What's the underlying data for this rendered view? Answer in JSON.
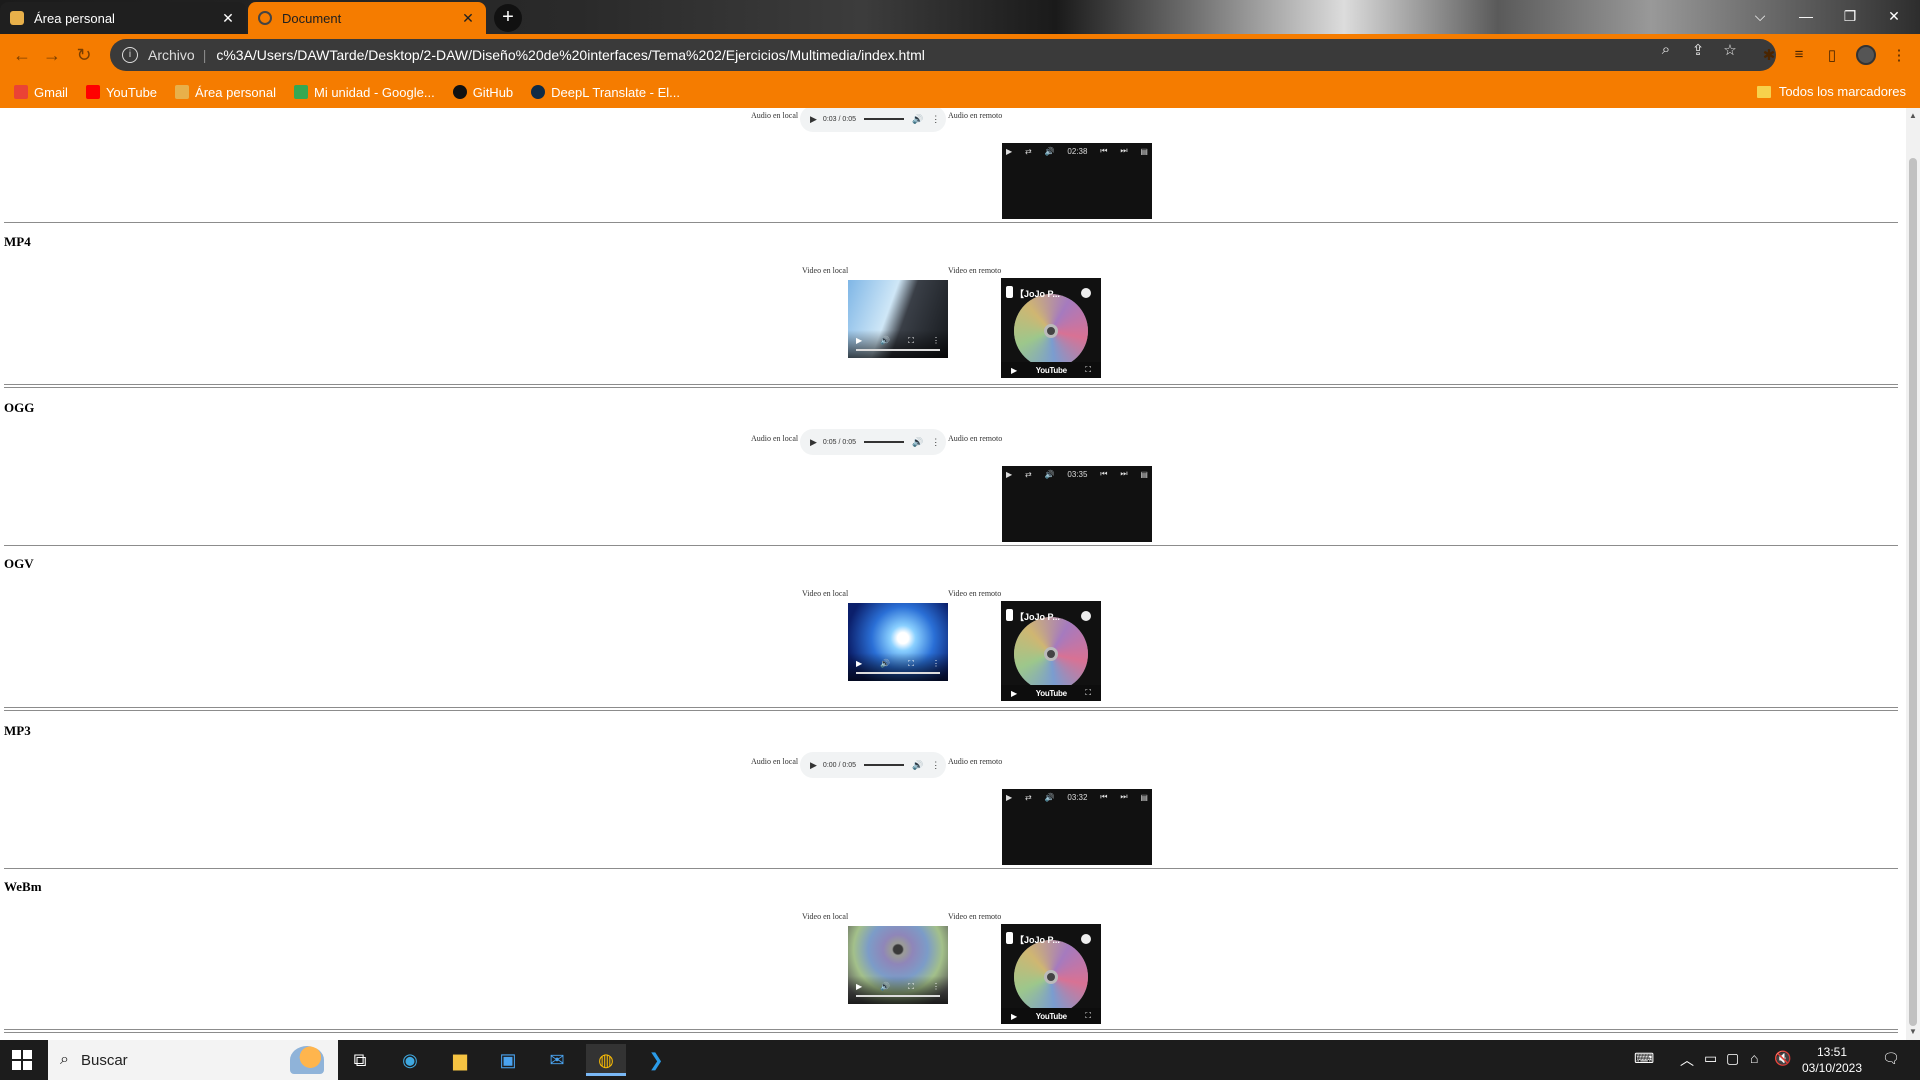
{
  "tabs": [
    {
      "title": "Área personal",
      "active": false
    },
    {
      "title": "Document",
      "active": true
    }
  ],
  "toolbar": {
    "scheme": "Archivo",
    "url": "c%3A/Users/DAWTarde/Desktop/2-DAW/Diseño%20de%20interfaces/Tema%202/Ejercicios/Multimedia/index.html"
  },
  "bookmarks": [
    {
      "label": "Gmail",
      "icon": "gmail-icon",
      "color": "#ea4335"
    },
    {
      "label": "YouTube",
      "icon": "youtube-icon",
      "color": "#ff0000"
    },
    {
      "label": "Área personal",
      "icon": "moodle-icon",
      "color": "#e8b04a"
    },
    {
      "label": "Mi unidad - Google...",
      "icon": "google-drive-icon",
      "color": "#34a853"
    },
    {
      "label": "GitHub",
      "icon": "github-icon",
      "color": "#111111"
    },
    {
      "label": "DeepL Translate - El...",
      "icon": "deepl-icon",
      "color": "#0f2b46"
    }
  ],
  "all_bookmarks": "Todos los marcadores",
  "page": {
    "audio_local": "Audio en local",
    "audio_remote": "Audio en remoto",
    "video_local": "Video en local",
    "video_remote": "Video en remoto",
    "sections": [
      {
        "name": "MP4"
      },
      {
        "name": "OGG"
      },
      {
        "name": "OGV"
      },
      {
        "name": "MP3"
      },
      {
        "name": "WeBm"
      }
    ],
    "audio_players": [
      {
        "time": "0:03 / 0:05",
        "remote_time": "02:38"
      },
      {
        "time": "0:05 / 0:05",
        "remote_time": "03:35"
      },
      {
        "time": "0:00 / 0:05",
        "remote_time": "03:32"
      }
    ],
    "youtube_title": "【JoJo P...",
    "youtube_brand": "YouTube"
  },
  "taskbar": {
    "search_placeholder": "Buscar",
    "time": "13:51",
    "date": "03/10/2023"
  },
  "colors": {
    "accent": "#f57c00",
    "taskbar": "#1c1c1c"
  }
}
